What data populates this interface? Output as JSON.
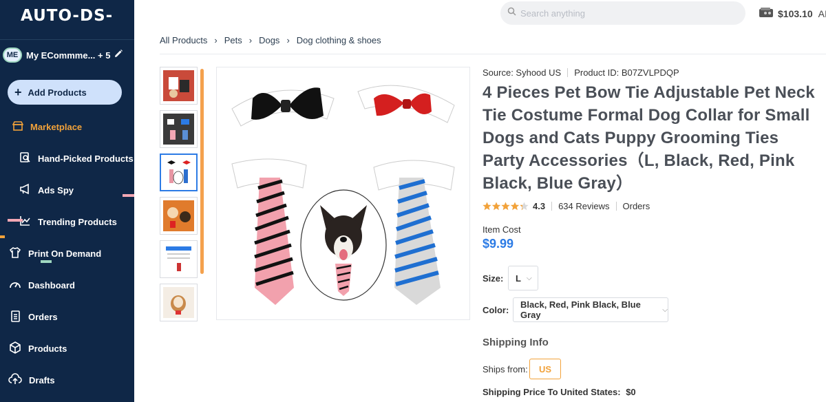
{
  "app": {
    "logo_text": "AUTO-DS-",
    "store": {
      "initials": "ME",
      "name": "My ECommme... + 5"
    },
    "add_products_label": "Add Products",
    "nav": [
      {
        "label": "Marketplace",
        "icon": "store-icon",
        "active": true
      },
      {
        "label": "Hand-Picked Products",
        "icon": "hand-picked-icon",
        "active": false
      },
      {
        "label": "Ads Spy",
        "icon": "megaphone-icon",
        "active": false
      },
      {
        "label": "Trending Products",
        "icon": "trending-chart-icon",
        "active": false
      },
      {
        "label": "Print On Demand",
        "icon": "tshirt-icon",
        "active": false
      },
      {
        "label": "Dashboard",
        "icon": "gauge-icon",
        "active": false
      },
      {
        "label": "Orders",
        "icon": "clipboard-icon",
        "active": false
      },
      {
        "label": "Products",
        "icon": "box-icon",
        "active": false
      },
      {
        "label": "Drafts",
        "icon": "cloud-upload-icon",
        "active": false
      }
    ],
    "colors": {
      "sidebar_bg": "#0f2747",
      "accent_orange": "#f2a23a",
      "accent_blue": "#2c7be5",
      "add_btn_bg": "#cfe1fb"
    }
  },
  "header": {
    "search": {
      "placeholder": "Search anything",
      "value": ""
    },
    "wallet": {
      "amount": "$103.10",
      "extra": "AI:"
    }
  },
  "breadcrumb": [
    "All Products",
    "Pets",
    "Dogs",
    "Dog clothing & shoes"
  ],
  "product": {
    "source": "Source: Syhood US",
    "product_id": "Product ID: B07ZVLPDQP",
    "title": "4 Pieces Pet Bow Tie Adjustable Pet Neck Tie Costume Formal Dog Collar for Small Dogs and Cats Puppy Grooming Ties Party Accessories（L, Black, Red, Pink Black, Blue Gray）",
    "rating": {
      "score": "4.3",
      "stars": 4.3,
      "reviews": "634 Reviews",
      "orders": "Orders"
    },
    "item_cost_label": "Item Cost",
    "item_cost": "$9.99",
    "size_label": "Size:",
    "size_value": "L",
    "color_label": "Color:",
    "color_value": "Black, Red, Pink Black, Blue Gray",
    "shipping_info_label": "Shipping Info",
    "ships_from_label": "Ships from:",
    "ships_from_value": "US",
    "shipping_price_label": "Shipping Price To United States:",
    "shipping_price_value": "$0",
    "thumbnail_count": 6,
    "selected_thumbnail": 3
  }
}
